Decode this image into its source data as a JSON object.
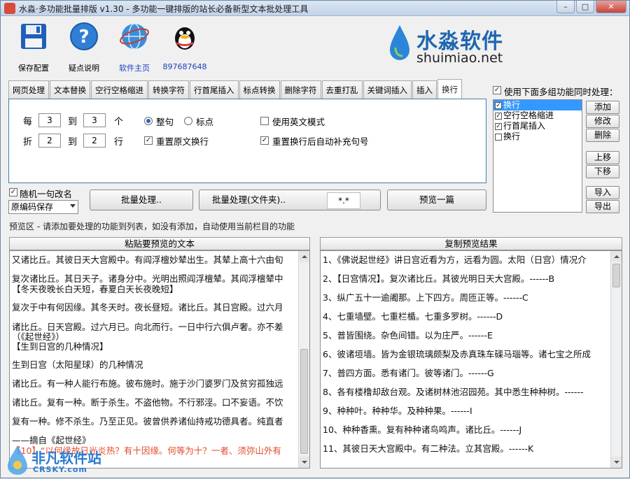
{
  "window": {
    "title": "水淼·多功能批量排版 v1.30 - 多功能一键排版的站长必备新型文本批处理工具",
    "min": "–",
    "max": "□",
    "close": "✕"
  },
  "toolbar": {
    "save_label": "保存配置",
    "help_label": "疑点说明",
    "home_label": "软件主页",
    "qq_label": "897687648"
  },
  "brand": {
    "cn": "水淼软件",
    "en": "shuimiao.net",
    "accent": "#1e66b0"
  },
  "tabs": [
    "网页处理",
    "文本替换",
    "空行空格缩进",
    "转换字符",
    "行首尾插入",
    "标点转换",
    "删除字符",
    "去重打乱",
    "关键词插入",
    "插入",
    "换行"
  ],
  "active_tab": "换行",
  "panel": {
    "every": "每",
    "to1": "到",
    "unit1": "个",
    "val1a": "3",
    "val1b": "3",
    "fold": "折",
    "to2": "到",
    "unit2": "行",
    "val2a": "2",
    "val2b": "2",
    "radio_sentence": "整句",
    "radio_punct": "标点",
    "english_mode": "使用英文模式",
    "reset_newline": "重置原文换行",
    "reset_newline_punct": "重置换行后自动补充句号"
  },
  "right": {
    "use_multi": "使用下面多组功能同时处理：",
    "items": [
      {
        "label": "换行",
        "checked": "✓"
      },
      {
        "label": "空行空格缩进",
        "checked": "✓"
      },
      {
        "label": "行首尾插入",
        "checked": "✓"
      },
      {
        "label": "换行",
        "checked": ""
      }
    ],
    "btn_add": "添加",
    "btn_edit": "修改",
    "btn_del": "删除",
    "btn_up": "上移",
    "btn_down": "下移",
    "btn_import": "导入",
    "btn_export": "导出"
  },
  "controls": {
    "random_rename": "随机一句改名",
    "encoding": "原编码保存",
    "batch": "批量处理..",
    "batch_folder": "批量处理(文件夹)..",
    "ext": "*.*",
    "preview_one": "预览一篇"
  },
  "hint": "预览区 - 请添加要处理的功能到列表，如没有添加，自动使用当前栏目的功能",
  "left_pane": {
    "header": "粘贴要预览的文本",
    "lines": [
      "又诸比丘。其彼日天大宫殿中。有阎浮檀妙辇出生。其辇上高十六由旬",
      "复次诸比丘。其日天子。诸身分中。光明出照阎浮檀辇。其阎浮檀辇中",
      "【冬天夜晚长白天短，春夏白天长夜晚短】",
      "复次于中有何因缘。其冬天时。夜长昼短。诸比丘。其日宫殿。过六月",
      "诸比丘。日天宫殿。过六月已。向北而行。一日中行六俱卢奢。亦不差",
      "（《起世经》）",
      "【生到日宫的几种情况】",
      "生到日宫（太阳星球）的几种情况",
      "诸比丘。有一种人能行布施。彼布施时。施于沙门婆罗门及贫穷孤独远",
      "诸比丘。复有一种。断于杀生。不盗他物。不行邪淫。口不妄语。不饮",
      "复有一种。修不杀生。乃至正见。彼曾供养诸仙持戒功德具者。纯直者",
      "——摘自《起世经》",
      "【10】“以何缘故日光炎热？有十因缘。何等为十？一者、须弥山外有"
    ]
  },
  "right_pane": {
    "header": "复制预览结果",
    "lines": [
      "1、《佛说起世经》讲日宫近看为方，远看为圆。太阳（日宫）情况介",
      "2、【日宫情况】。复次诸比丘。其彼光明日天大宫殿。------B",
      "3、纵广五十一逾阇那。上下四方。周匝正等。------C",
      "4、七重墙壁。七重栏楯。七重多罗树。------D",
      "5、普皆围绕。杂色间错。以为庄严。------E",
      "6、彼诸垣墙。皆为金银琉璃颇梨及赤真珠车磲马瑙等。诸七宝之所成",
      "7、普四方面。悉有诸门。彼等诸门。------G",
      "8、各有楼橹却敌台观。及诸树林池沼园苑。其中悉生种种树。------",
      "9、种种叶。种种华。及种种果。------I",
      "10、种种香熏。复有种种诸鸟鸣声。诸比丘。------J",
      "11、其彼日天大宫殿中。有二种法。立其宫殿。------K"
    ]
  },
  "watermark": {
    "cn": "非凡软件站",
    "en": "CRSKY.com"
  }
}
